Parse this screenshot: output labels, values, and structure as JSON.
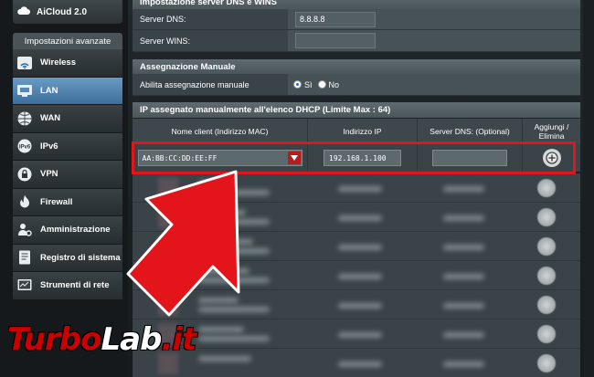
{
  "sidebar": {
    "aicloud_label": "AiCloud 2.0",
    "advanced_header": "Impostazioni avanzate",
    "items": [
      {
        "label": "Wireless",
        "icon": "wireless-icon"
      },
      {
        "label": "LAN",
        "icon": "lan-icon",
        "active": true
      },
      {
        "label": "WAN",
        "icon": "wan-globe-icon"
      },
      {
        "label": "IPv6",
        "icon": "ipv6-icon"
      },
      {
        "label": "VPN",
        "icon": "vpn-icon"
      },
      {
        "label": "Firewall",
        "icon": "firewall-icon"
      },
      {
        "label": "Amministrazione",
        "icon": "admin-gear-icon"
      },
      {
        "label": "Registro di sistema",
        "icon": "system-log-icon"
      },
      {
        "label": "Strumenti di rete",
        "icon": "network-tools-icon"
      }
    ]
  },
  "dns_section": {
    "title": "Impostazione server DNS e WINS",
    "dns_label": "Server DNS:",
    "dns_value": "8.8.8.8",
    "wins_label": "Server WINS:",
    "wins_value": ""
  },
  "manual_section": {
    "title": "Assegnazione Manuale",
    "enable_label": "Abilita assegnazione manuale",
    "option_yes": "Sì",
    "option_no": "No",
    "selected": "Sì"
  },
  "dhcp_list": {
    "title": "IP assegnato manualmente all'elenco DHCP (Limite Max : 64)",
    "columns": [
      "Nome client (Indirizzo MAC)",
      "Indirizzo IP",
      "Server DNS: (Optional)",
      "Aggiungi / Elimina"
    ],
    "new_entry": {
      "mac": "AA:BB:CC:DD:EE:FF",
      "ip": "192.168.1.100",
      "dns": ""
    }
  },
  "watermark": {
    "part1": "Turbo",
    "part2": "Lab",
    "part3": ".it"
  },
  "colors": {
    "highlight": "#e3151b",
    "active_nav": "#4f7fad",
    "arrow": "#e3151b"
  }
}
